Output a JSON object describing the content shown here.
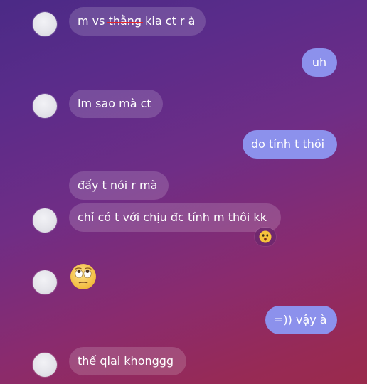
{
  "messages": [
    {
      "id": "m1",
      "direction": "incoming",
      "parts": [
        {
          "text": "m vs ",
          "struck": false
        },
        {
          "text": "thằng",
          "struck": true
        },
        {
          "text": " kia ct r à",
          "struck": false
        }
      ]
    },
    {
      "id": "m2",
      "direction": "outgoing",
      "text": "uh"
    },
    {
      "id": "m3",
      "direction": "incoming",
      "text": "lm sao mà ct"
    },
    {
      "id": "m4",
      "direction": "outgoing",
      "text": "do tính t thôi"
    },
    {
      "id": "m5",
      "direction": "incoming",
      "text": "đấy t nói r mà"
    },
    {
      "id": "m6",
      "direction": "incoming",
      "text": "chỉ có t với chịu đc tính m thôi kk",
      "reaction": "astonished-face-emoji"
    },
    {
      "id": "m7",
      "direction": "incoming",
      "emoji": "face-with-rolling-eyes-emoji"
    },
    {
      "id": "m8",
      "direction": "outgoing",
      "text": "=)) vậy à"
    },
    {
      "id": "m9",
      "direction": "incoming",
      "text": "thế qlai khonggg"
    }
  ],
  "colors": {
    "incoming_bubble": "rgba(255,255,255,0.16)",
    "outgoing_bubble": "#8c91ec",
    "strike": "#e3242b",
    "text": "#ffffff"
  }
}
